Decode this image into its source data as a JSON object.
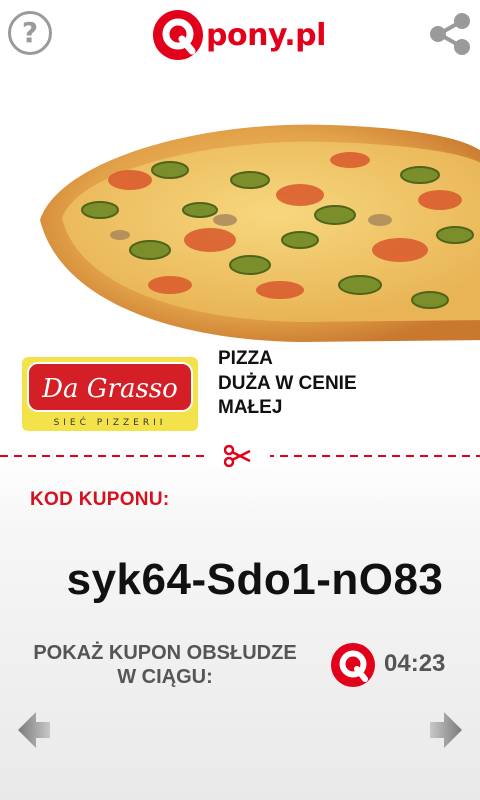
{
  "header": {
    "help_glyph": "?",
    "logo_text": "pony.pl",
    "share_icon": "share-icon"
  },
  "offer": {
    "brand": "Da Grasso",
    "brand_tagline": "SIEĆ PIZZERII",
    "lines": [
      "PIZZA",
      "DUŻA W CENIE",
      "MAŁEJ"
    ]
  },
  "coupon": {
    "code_label": "KOD KUPONU:",
    "code_value": "syk64-Sdo1-nO83",
    "show_text_line1": "POKAŻ KUPON OBSŁUDZE",
    "show_text_line2": "W CIĄGU:",
    "timer": "04:23"
  },
  "colors": {
    "brand_red": "#e3001b",
    "label_red": "#d8101e",
    "gray_text": "#555555",
    "icon_gray": "#9a9a9a"
  }
}
